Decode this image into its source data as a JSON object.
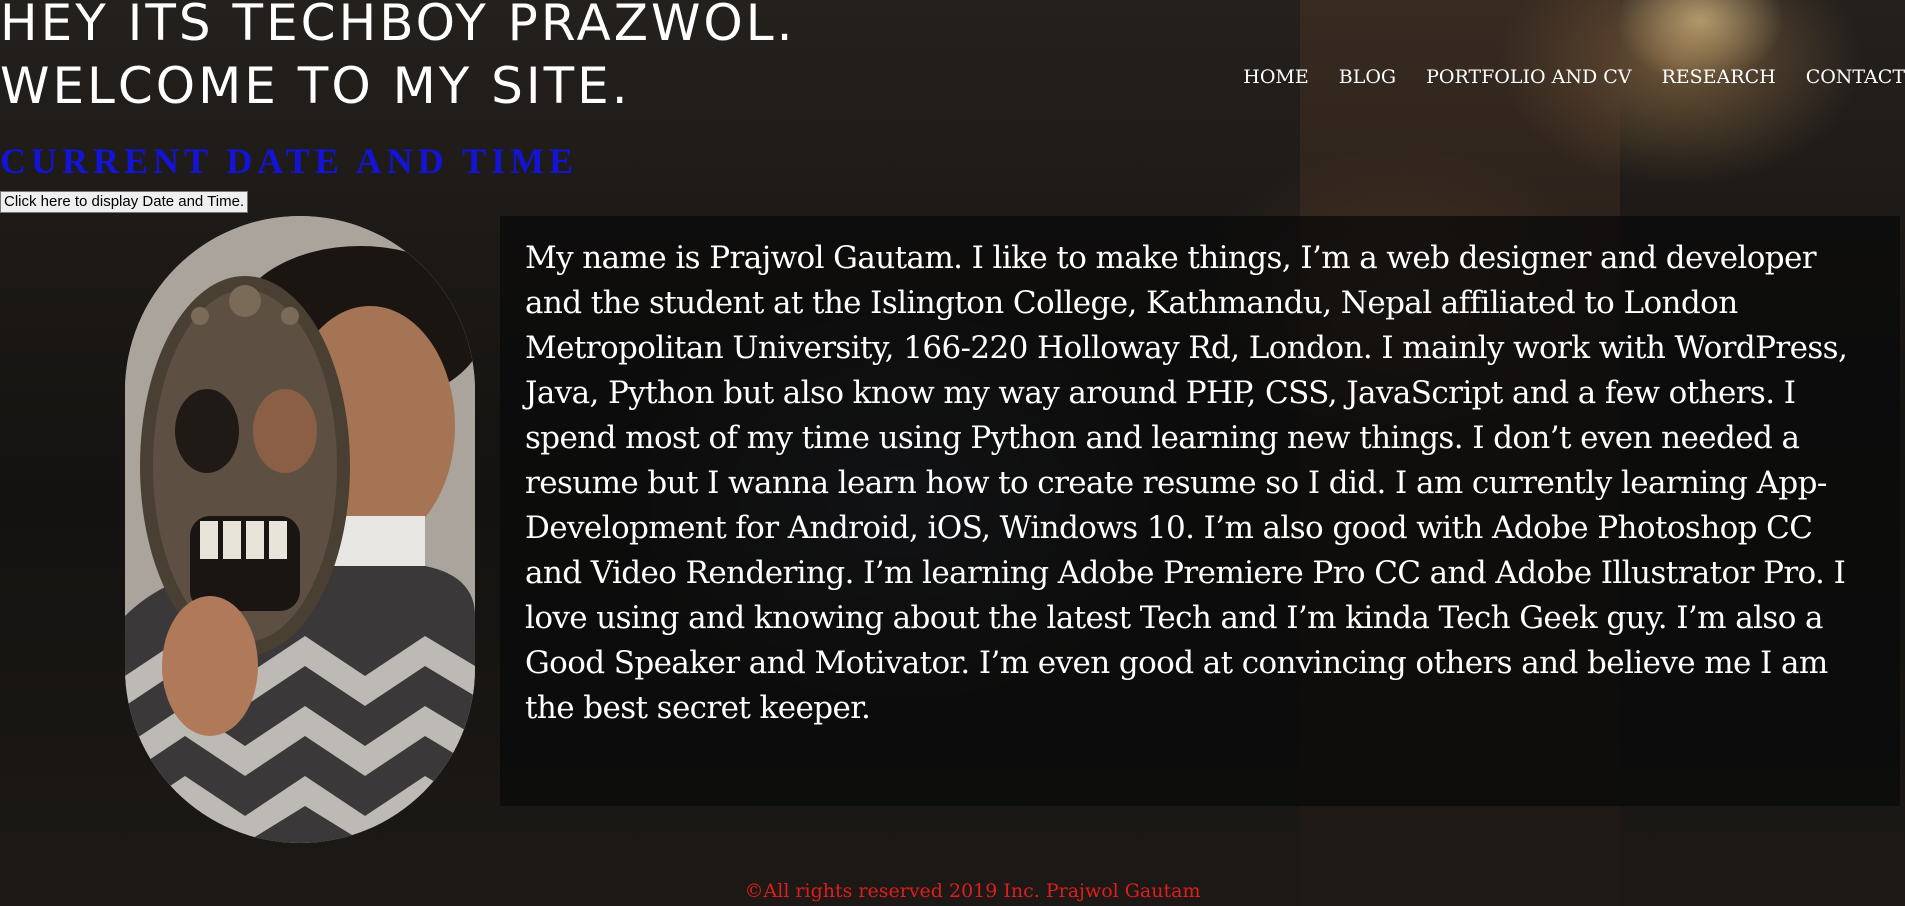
{
  "header": {
    "title_line1": "HEY ITS TECHBOY PRAZWOL.",
    "title_line2": "WELCOME TO MY SITE."
  },
  "nav": {
    "items": [
      {
        "label": "HOME"
      },
      {
        "label": "BLOG"
      },
      {
        "label": "PORTFOLIO AND CV"
      },
      {
        "label": "RESEARCH"
      },
      {
        "label": "CONTACT"
      }
    ]
  },
  "datetime": {
    "heading": "CURRENT DATE AND TIME",
    "button_label": "Click here to display Date and Time.",
    "heading_color": "#1414d6"
  },
  "about": {
    "text": "My name is Prajwol Gautam. I like to make things, I’m a web designer and developer and the student at the Islington College, Kathmandu, Nepal affiliated to London Metropolitan University, 166-220 Holloway Rd, London. I mainly work with WordPress, Java, Python but also know my way around PHP, CSS, JavaScript and a few others. I spend most of my time using Python and learning new things. I don’t even needed a resume but I wanna learn how to create resume so I did. I am currently learning App-Development for Android, iOS, Windows 10. I’m also good with Adobe Photoshop CC and Video Rendering. I’m learning Adobe Premiere Pro CC and Adobe Illustrator Pro. I love using and knowing about the latest Tech and I’m kinda Tech Geek guy. I’m also a Good Speaker and Motivator. I’m even good at convincing others and believe me I am the best secret keeper."
  },
  "footer": {
    "text": "©All rights reserved 2019 Inc. Prajwol Gautam",
    "color": "#e01d1d"
  }
}
